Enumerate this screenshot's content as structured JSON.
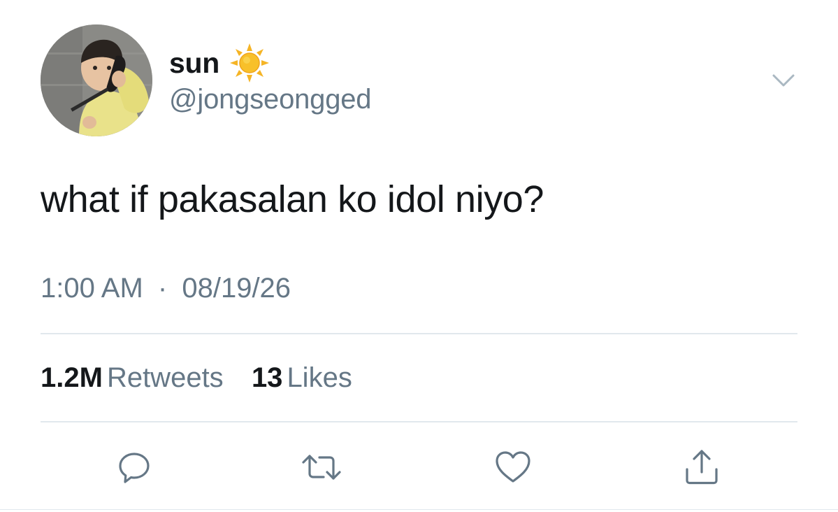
{
  "user": {
    "display_name": "sun",
    "name_emoji_icon": "sun-emoji-icon",
    "handle": "@jongseongged",
    "avatar_icon": "profile-photo"
  },
  "tweet": {
    "text": "what if pakasalan ko idol niyo?",
    "time": "1:00 AM",
    "separator": "·",
    "date": "08/19/26"
  },
  "stats": {
    "retweets_count": "1.2M",
    "retweets_label": "Retweets",
    "likes_count": "13",
    "likes_label": "Likes"
  },
  "actions": [
    {
      "icon": "reply-icon"
    },
    {
      "icon": "retweet-icon"
    },
    {
      "icon": "like-heart-icon"
    },
    {
      "icon": "share-icon"
    }
  ],
  "colors": {
    "text_primary": "#14171a",
    "text_secondary": "#657786",
    "divider": "#e1e8ed",
    "icon": "#657786"
  }
}
